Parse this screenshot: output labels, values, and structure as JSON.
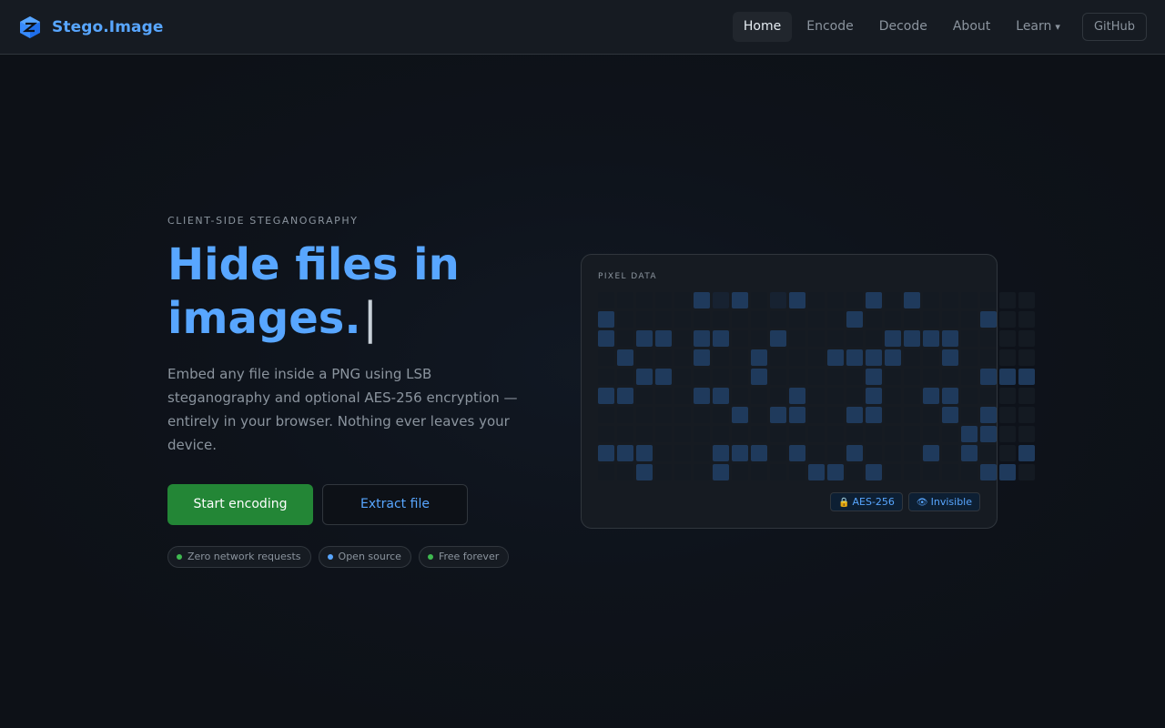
{
  "app": {
    "name": "Stego.Image"
  },
  "nav": {
    "items": [
      "Home",
      "Encode",
      "Decode",
      "About",
      "Learn"
    ],
    "learn_caret": "▾",
    "github": "GitHub"
  },
  "hero": {
    "eyebrow": "CLIENT-SIDE STEGANOGRAPHY",
    "headline_line1": "Hide files in",
    "headline_line2": "images.",
    "cursor": "|",
    "description": "Embed any file inside a PNG using LSB steganography and optional AES-256 encryption — entirely in your browser. Nothing ever leaves your device.",
    "primary_button": "Start encoding",
    "secondary_button": "Extract file",
    "pills": [
      {
        "label": "Zero network requests",
        "dot_color": "#3fb950"
      },
      {
        "label": "Open source",
        "dot_color": "#58a6ff"
      },
      {
        "label": "Free forever",
        "dot_color": "#3fb950"
      }
    ]
  },
  "card": {
    "label": "PIXEL DATA",
    "badges": [
      {
        "icon": "🔒",
        "label": "AES-256"
      },
      {
        "icon": "👁",
        "label": "Invisible"
      }
    ],
    "grid": [
      "00000121021000101000000",
      "10000000000001000000100",
      "10110110010000011110000",
      "01000100100011110010000",
      "00110000100000100000111",
      "11000110001000100110000",
      "00000001011001100010100",
      "00000000000000000001100",
      "11100011101001000101001",
      "00100010000110100000110"
    ]
  },
  "colors": {
    "accent": "#58a6ff",
    "primary_button": "#238636",
    "cell_on": "#1f3a5c",
    "cell_dim": "#172231",
    "cell_off": "#141a22"
  }
}
